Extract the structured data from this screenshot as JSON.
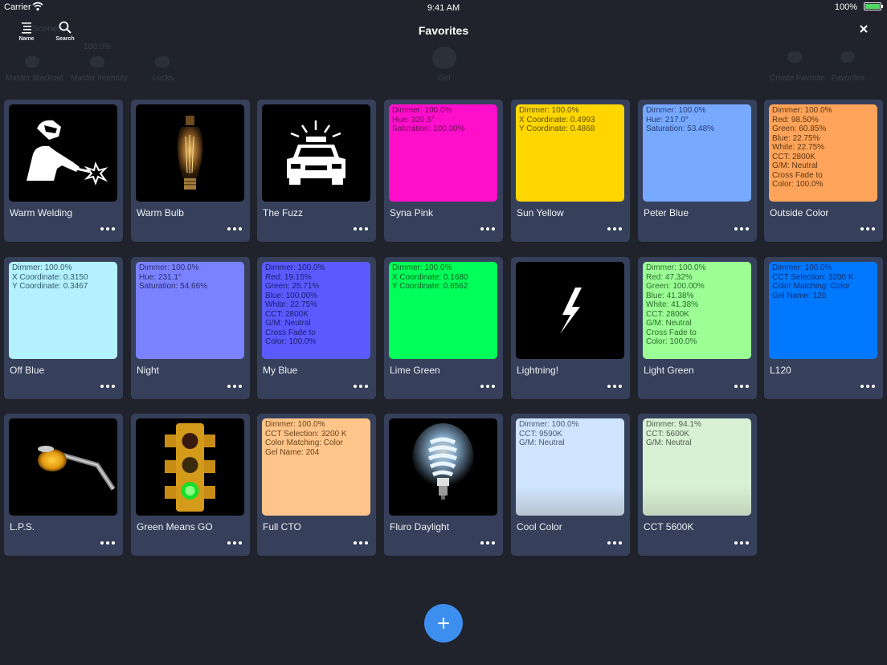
{
  "status": {
    "carrier": "Carrier",
    "time": "9:41 AM",
    "battery": "100%",
    "battery_level": 1.0
  },
  "header": {
    "title": "Favorites",
    "sort_label": "Name",
    "search_label": "Search"
  },
  "background": {
    "back_label": "Scenes",
    "intensity": "100.0%",
    "items": [
      "Master Blackout",
      "Master Intensity",
      "Locks",
      "Gel",
      "Create Favorite",
      "Favorites"
    ]
  },
  "favorites": [
    {
      "name": "Warm Welding",
      "thumb": "welding-pictogram",
      "bg": "#000000",
      "info": ""
    },
    {
      "name": "Warm Bulb",
      "thumb": "edison-bulb-photo",
      "bg": "#000000",
      "info": ""
    },
    {
      "name": "The Fuzz",
      "thumb": "police-car-pictogram",
      "bg": "#000000",
      "info": ""
    },
    {
      "name": "Syna Pink",
      "thumb": "color",
      "bg": "#ff0fca",
      "text": "#6a0858",
      "info": "Dimmer: 100.0%\nHue: 320.5°\nSaturation: 100.00%"
    },
    {
      "name": "Sun Yellow",
      "thumb": "color",
      "bg": "#ffd600",
      "text": "#5e5000",
      "info": "Dimmer: 100.0%\nX Coordinate: 0.4993\nY Coordinate: 0.4868"
    },
    {
      "name": "Peter Blue",
      "thumb": "color",
      "bg": "#76a9ff",
      "text": "#253d73",
      "info": "Dimmer: 100.0%\nHue: 217.0°\nSaturation: 53.48%"
    },
    {
      "name": "Outside Color",
      "thumb": "color",
      "bg": "#ffa45a",
      "text": "#5c3510",
      "info": "Dimmer: 100.0%\nRed: 98.50%\nGreen: 60.85%\nBlue: 22.75%\nWhite: 22.75%\nCCT: 2800K\nG/M: Neutral\nCross Fade to\nColor: 100.0%"
    },
    {
      "name": "Off Blue",
      "thumb": "color",
      "bg": "#b4f1ff",
      "text": "#2f5a66",
      "info": "Dimmer: 100.0%\nX Coordinate: 0.3150\nY Coordinate: 0.3467"
    },
    {
      "name": "Night",
      "thumb": "color",
      "bg": "#7a82ff",
      "text": "#2a2c6e",
      "info": "Dimmer: 100.0%\nHue: 231.1°\nSaturation: 54.66%"
    },
    {
      "name": "My Blue",
      "thumb": "color",
      "bg": "#5a5aff",
      "text": "#1c1c70",
      "info": "Dimmer: 100.0%\nRed: 19.15%\nGreen: 25.71%\nBlue: 100.00%\nWhite: 22.75%\nCCT: 2800K\nG/M: Neutral\nCross Fade to\nColor: 100.0%"
    },
    {
      "name": "Lime Green",
      "thumb": "color",
      "bg": "#00ff58",
      "text": "#03601f",
      "info": "Dimmer: 100.0%\nX Coordinate: 0.1680\nY Coordinate: 0.6562"
    },
    {
      "name": "Lightning!",
      "thumb": "lightning-bolt",
      "bg": "#000000",
      "info": ""
    },
    {
      "name": "Light Green",
      "thumb": "color",
      "bg": "#9cff96",
      "text": "#2c6b2a",
      "info": "Dimmer: 100.0%\nRed: 47.32%\nGreen: 100.00%\nBlue: 41.38%\nWhite: 41.38%\nCCT: 2800K\nG/M: Neutral\nCross Fade to\nColor: 100.0%"
    },
    {
      "name": "L120",
      "thumb": "color",
      "bg": "#0078ff",
      "text": "#0b2d6e",
      "info": "Dimmer: 100.0%\nCCT Selection: 3200 K\nColor Matching: Color\nGel Name: 120"
    },
    {
      "name": "L.P.S.",
      "thumb": "street-lamp-photo",
      "bg": "#000000",
      "info": ""
    },
    {
      "name": "Green Means GO",
      "thumb": "traffic-light-photo",
      "bg": "#000000",
      "info": ""
    },
    {
      "name": "Full CTO",
      "thumb": "color",
      "bg": "#ffc48a",
      "text": "#6a4418",
      "info": "Dimmer: 100.0%\nCCT Selection: 3200 K\nColor Matching: Color\nGel Name: 204"
    },
    {
      "name": "Fluro Daylight",
      "thumb": "fluorescent-bulb-photo",
      "bg": "#000000",
      "info": ""
    },
    {
      "name": "Cool Color",
      "thumb": "color",
      "bg": "#cfe4ff",
      "bg2": "#b9c3d0",
      "text": "#4b5a6e",
      "info": "Dimmer: 100.0%\nCCT: 9590K\nG/M: Neutral"
    },
    {
      "name": "CCT 5600K",
      "thumb": "color",
      "bg": "#d8f0d4",
      "bg2": "#c2d3bb",
      "text": "#4e5f4d",
      "info": "Dimmer: 94.1%\nCCT: 5600K\nG/M: Neutral"
    }
  ]
}
